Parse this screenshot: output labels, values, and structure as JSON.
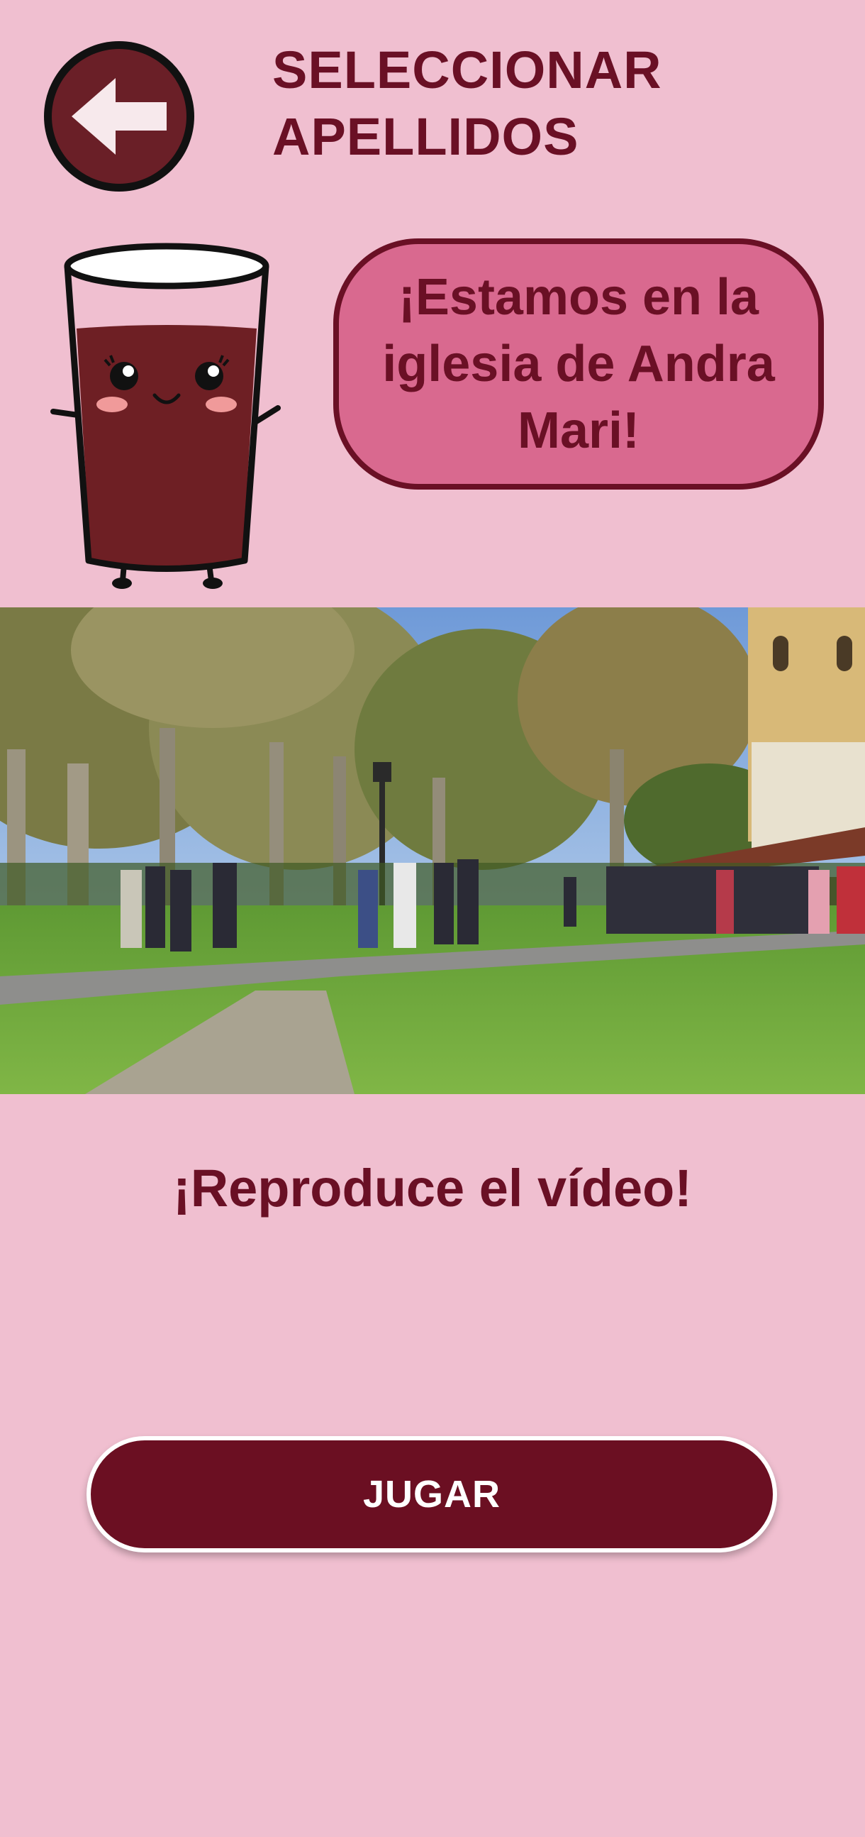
{
  "header": {
    "back_icon": "arrow-left-icon",
    "title_line1": "SELECCIONAR",
    "title_line2": "APELLIDOS"
  },
  "mascot": {
    "icon": "cider-glass-mascot"
  },
  "speech": {
    "text": "¡Estamos en la iglesia de Andra Mari!"
  },
  "scene": {
    "description_icon": "church-courtyard-photo"
  },
  "instruction": {
    "text": "¡Reproduce el vídeo!"
  },
  "play": {
    "label": "JUGAR"
  },
  "colors": {
    "background": "#f0bfd0",
    "accent": "#6a1025",
    "bubble": "#d9698f",
    "button": "#6b0f22"
  }
}
